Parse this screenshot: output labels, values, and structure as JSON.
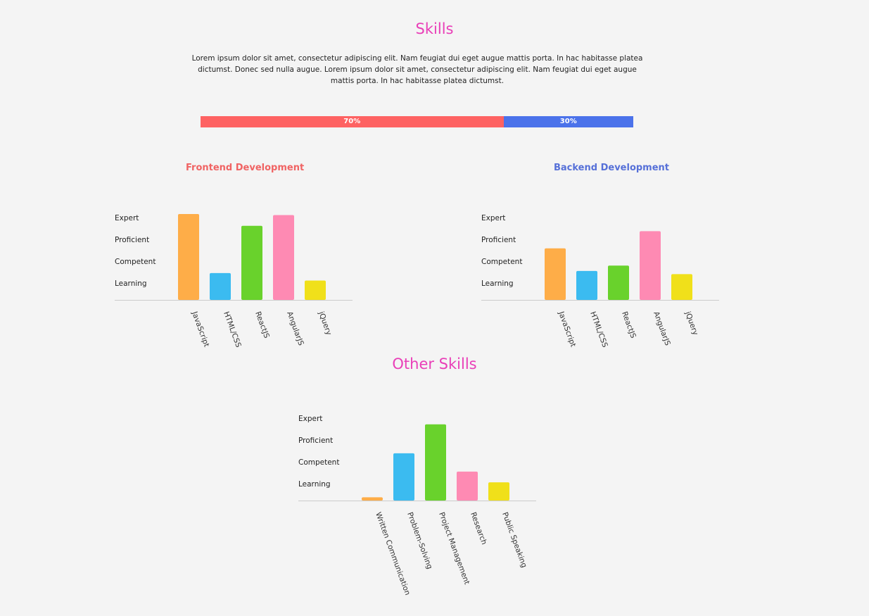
{
  "header": {
    "title": "Skills",
    "intro": "Lorem ipsum dolor sit amet, consectetur adipiscing elit. Nam feugiat dui eget augue mattis porta. In hac habitasse platea dictumst. Donec sed nulla augue. Lorem ipsum dolor sit amet, consectetur adipiscing elit. Nam feugiat dui eget augue mattis porta. In hac habitasse platea dictumst."
  },
  "split": {
    "frontend": {
      "value": 0.7,
      "label": "70%",
      "color": "#fe6262"
    },
    "backend": {
      "value": 0.3,
      "label": "30%",
      "color": "#4b72ea"
    }
  },
  "frontend": {
    "title": "Frontend Development",
    "title_color": "#f06363"
  },
  "backend": {
    "title": "Backend Development",
    "title_color": "#5670d8"
  },
  "other": {
    "title": "Other Skills"
  },
  "colors": {
    "title_pink": "#e93fb8",
    "bar_palette": [
      "#fead48",
      "#3bbbf0",
      "#69d22c",
      "#fe8ab3",
      "#f0e01a"
    ],
    "axis": "#cccccc"
  },
  "chart_data": [
    {
      "type": "bar",
      "title": "Frontend Development",
      "levels": [
        "Learning",
        "Competent",
        "Proficient",
        "Expert"
      ],
      "ylim": [
        0,
        4
      ],
      "categories": [
        "JavaScript",
        "HTML/CSS",
        "ReactJS",
        "AngularJS",
        "jQuery"
      ],
      "values": [
        4.0,
        1.25,
        3.45,
        3.95,
        0.9
      ]
    },
    {
      "type": "bar",
      "title": "Backend Development",
      "levels": [
        "Learning",
        "Competent",
        "Proficient",
        "Expert"
      ],
      "ylim": [
        0,
        4
      ],
      "categories": [
        "JavaScript",
        "HTML/CSS",
        "ReactJS",
        "AngularJS",
        "jQuery"
      ],
      "values": [
        2.4,
        1.35,
        1.6,
        3.2,
        1.2
      ]
    },
    {
      "type": "bar",
      "title": "Other Skills",
      "levels": [
        "Learning",
        "Competent",
        "Proficient",
        "Expert"
      ],
      "ylim": [
        0,
        4
      ],
      "categories": [
        "Written Communication",
        "Problem-Solving",
        "Project Management",
        "Research",
        "Public Speaking"
      ],
      "values": [
        0.15,
        2.2,
        3.55,
        1.35,
        0.85
      ]
    }
  ]
}
